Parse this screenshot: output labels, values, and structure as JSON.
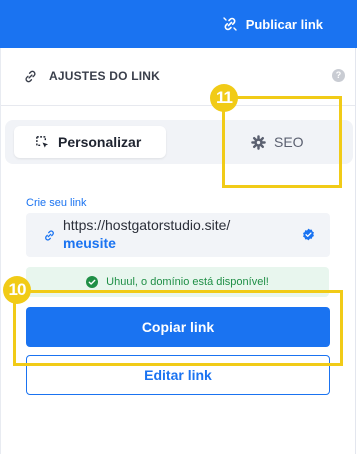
{
  "topbar": {
    "publish_label": "Publicar link",
    "color": "#1a73f1"
  },
  "panel": {
    "title": "AJUSTES DO LINK",
    "help_label": "?",
    "tabs": [
      {
        "label": "Personalizar",
        "icon": "customize-icon",
        "active": true
      },
      {
        "label": "SEO",
        "icon": "gear-icon",
        "active": false
      }
    ],
    "link": {
      "label": "Crie seu link",
      "domain": "https://hostgatorstudio.site/",
      "slug": "meusite"
    },
    "availability_message": "Uhuul, o domínio está disponível!",
    "copy_button": "Copiar link",
    "edit_button": "Editar link"
  },
  "callouts": [
    {
      "number": "11",
      "target": "tab-seo"
    },
    {
      "number": "10",
      "target": "copy-link-button"
    }
  ],
  "colors": {
    "accent": "#1a73f1",
    "success": "#1f8f46",
    "callout": "#f1cb17"
  }
}
